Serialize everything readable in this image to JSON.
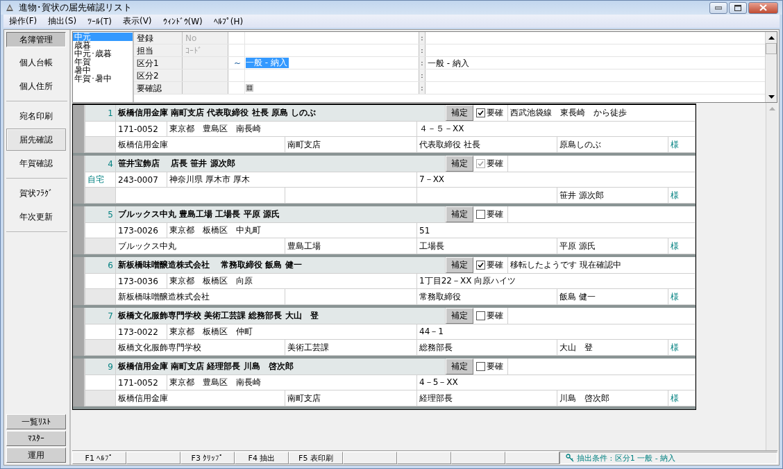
{
  "window": {
    "title": "進物･賀状の届先確認リスト"
  },
  "menu": [
    "操作(F)",
    "抽出(S)",
    "ﾂｰﾙ(T)",
    "表示(V)",
    "ｳｨﾝﾄﾞｳ(W)",
    "ﾍﾙﾌﾟ(H)"
  ],
  "sidebar": {
    "top": [
      {
        "label": "名簿管理",
        "selected": true
      }
    ],
    "groups": [
      {
        "items": [
          {
            "label": "個人台帳",
            "selected": false
          },
          {
            "label": "個人住所",
            "selected": false
          }
        ]
      },
      {
        "items": [
          {
            "label": "宛名印刷",
            "selected": false
          },
          {
            "label": "届先確認",
            "selected": true
          },
          {
            "label": "年賀確認",
            "selected": false
          }
        ]
      },
      {
        "items": [
          {
            "label": "賀状ﾌﾗｸﾞ",
            "selected": false
          },
          {
            "label": "年次更新",
            "selected": false
          }
        ]
      }
    ],
    "bottom": [
      {
        "label": "一覧ﾘｽﾄ",
        "selected": false
      },
      {
        "label": "ﾏｽﾀｰ",
        "selected": false
      },
      {
        "label": "運用",
        "selected": false
      }
    ]
  },
  "filter": {
    "categories": [
      {
        "label": "中元",
        "selected": true
      },
      {
        "label": "歳暮",
        "selected": false
      },
      {
        "label": "中元･歳暮",
        "selected": false
      },
      {
        "label": "年賀",
        "selected": false
      },
      {
        "label": "暑中",
        "selected": false
      },
      {
        "label": "年賀･暑中",
        "selected": false
      }
    ],
    "fields": [
      {
        "kind": "text",
        "label": "登録",
        "placeholder": "No",
        "separator": ":"
      },
      {
        "kind": "text",
        "label": "担当",
        "placeholder": "ｺｰﾄﾞ",
        "separator": ":"
      },
      {
        "kind": "text",
        "label": "区分1",
        "range_mark": "~",
        "value": "一般 - 納入",
        "separator": ":",
        "result": "一般 - 納入"
      },
      {
        "kind": "text",
        "label": "区分2",
        "separator": ":"
      },
      {
        "kind": "checkbox",
        "label": "要確認",
        "separator": ":"
      }
    ]
  },
  "records": [
    {
      "number": "1",
      "title": "板橋信用金庫 南町支店 代表取締役 社長 原島 しのぶ",
      "supplement": "補定",
      "check_label": "要確",
      "checked": true,
      "disabled": false,
      "note": "西武池袋線　東長崎　から徒歩",
      "zip": "171-0052",
      "address": "東京都　豊島区　南長崎",
      "address2": "４－５－XX",
      "company": "板橋信用金庫",
      "department": "南町支店",
      "position": "代表取締役 社長",
      "name": "原島しのぶ",
      "honorific": "様"
    },
    {
      "number": "4",
      "title": "笹井宝飾店　 店長 笹井 源次郎",
      "supplement": "補定",
      "check_label": "要確",
      "checked": true,
      "disabled": true,
      "address_label": "自宅",
      "zip": "243-0007",
      "address": "神奈川県 厚木市 厚木",
      "address2": "7－XX",
      "name": "笹井 源次郎",
      "honorific": "様"
    },
    {
      "number": "5",
      "title": "ブルックス中丸 豊島工場 工場長 平原 源氏",
      "supplement": "補定",
      "check_label": "要確",
      "checked": false,
      "disabled": false,
      "zip": "173-0026",
      "address": "東京都　板橋区　中丸町",
      "address2": "51",
      "company": "ブルックス中丸",
      "department": "豊島工場",
      "position": "工場長",
      "name": "平原 源氏",
      "honorific": "様"
    },
    {
      "number": "6",
      "title": "新板橋味噌醸造株式会社　 常務取締役 飯島 健一",
      "supplement": "補定",
      "check_label": "要確",
      "checked": true,
      "disabled": false,
      "note": "移転したようです 現在確認中",
      "zip": "173-0036",
      "address": "東京都　板橋区　向原",
      "address2": "1丁目22－XX 向原ハイツ",
      "company": "新板橋味噌醸造株式会社",
      "position": "常務取締役",
      "name": "飯島 健一",
      "honorific": "様"
    },
    {
      "number": "7",
      "title": "板橋文化服飾専門学校 美術工芸課 総務部長 大山　登",
      "supplement": "補定",
      "check_label": "要確",
      "checked": false,
      "disabled": false,
      "zip": "173-0022",
      "address": "東京都　板橋区　仲町",
      "address2": "44－1",
      "company": "板橋文化服飾専門学校",
      "department": "美術工芸課",
      "position": "総務部長",
      "name": "大山　登",
      "honorific": "様"
    },
    {
      "number": "9",
      "title": "板橋信用金庫 南町支店 経理部長 川島　啓次郎",
      "supplement": "補定",
      "check_label": "要確",
      "checked": false,
      "disabled": false,
      "zip": "171-0052",
      "address": "東京都　豊島区　南長崎",
      "address2": "4－5－XX",
      "company": "板橋信用金庫",
      "department": "南町支店",
      "position": "経理部長",
      "name": "川島　啓次郎",
      "honorific": "様"
    }
  ],
  "status_bar": {
    "keys": [
      {
        "kind": "key",
        "label": "F1 ﾍﾙﾌﾟ"
      },
      {
        "kind": "blank"
      },
      {
        "kind": "key",
        "label": "F3 ｸﾘｯﾌﾟ"
      },
      {
        "kind": "key",
        "label": "F4 抽出"
      },
      {
        "kind": "key",
        "label": "F5 表印刷"
      },
      {
        "kind": "blank"
      },
      {
        "kind": "blank"
      },
      {
        "kind": "blank"
      },
      {
        "kind": "blank"
      }
    ],
    "condition": "抽出条件 : 区分1 一般 - 納入"
  }
}
